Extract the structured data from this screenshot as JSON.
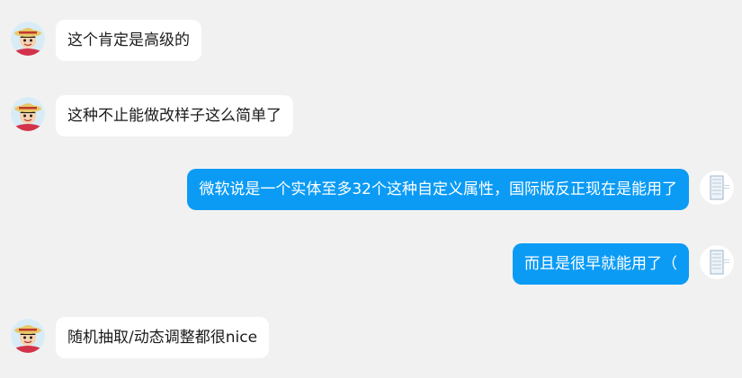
{
  "messages": [
    {
      "side": "left",
      "sender": "friend",
      "text": "这个肯定是高级的"
    },
    {
      "side": "left",
      "sender": "friend",
      "text": "这种不止能做改样子这么简单了"
    },
    {
      "side": "right",
      "sender": "self",
      "text": "微软说是一个实体至多32个这种自定义属性，国际版反正现在是能用了"
    },
    {
      "side": "right",
      "sender": "self",
      "text": "而且是很早就能用了（"
    },
    {
      "side": "left",
      "sender": "friend",
      "text": "随机抽取/动态调整都很nice"
    }
  ],
  "colors": {
    "background": "#f1f1f1",
    "incoming_bubble": "#ffffff",
    "outgoing_bubble": "#0b9bf5",
    "incoming_text": "#1b1b1b",
    "outgoing_text": "#ffffff"
  },
  "icons": {
    "friend_avatar": "cartoon-straw-hat-avatar-icon",
    "self_avatar": "building-tower-avatar-icon"
  }
}
